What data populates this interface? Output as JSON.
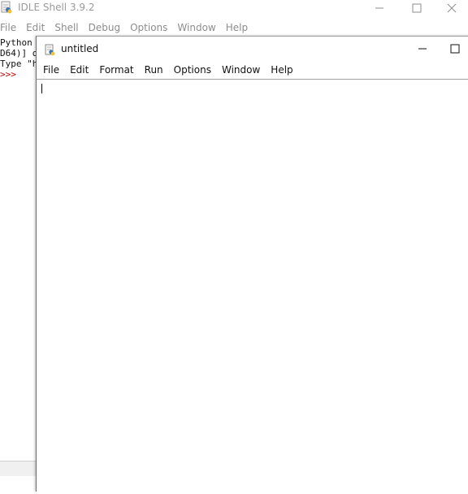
{
  "shell": {
    "title": "IDLE Shell 3.9.2",
    "menu": [
      "File",
      "Edit",
      "Shell",
      "Debug",
      "Options",
      "Window",
      "Help"
    ],
    "visible_lines": [
      "Python",
      "D64)] o",
      "Type \"h"
    ],
    "prompt": ">>>",
    "icons": {
      "app": "python-idle-icon",
      "minimize": "minimize-icon",
      "maximize": "maximize-icon",
      "close": "close-icon"
    }
  },
  "editor": {
    "title": "untitled",
    "menu": [
      "File",
      "Edit",
      "Format",
      "Run",
      "Options",
      "Window",
      "Help"
    ],
    "content": "",
    "icons": {
      "app": "python-file-icon",
      "minimize": "minimize-icon",
      "maximize": "maximize-icon"
    }
  },
  "colors": {
    "prompt": "#c00000",
    "inactive_text": "#8c8c8c",
    "border": "#6e6e6e"
  }
}
